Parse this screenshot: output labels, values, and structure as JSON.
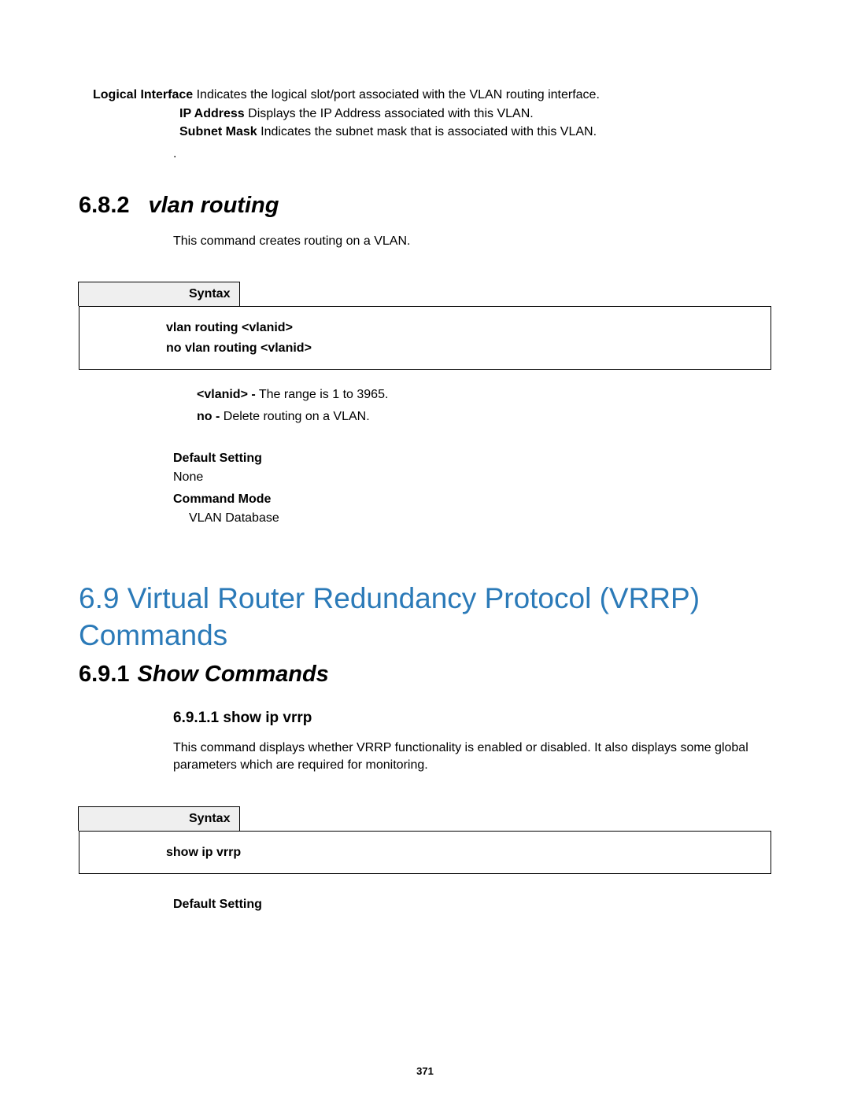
{
  "defs": {
    "logical_label": "Logical Interface",
    "logical_text": " Indicates the logical slot/port associated with the VLAN routing interface.",
    "ip_label": "IP Address",
    "ip_text": " Displays the IP Address associated with this VLAN.",
    "subnet_label": "Subnet Mask",
    "subnet_text": " Indicates the subnet mask that is associated with this VLAN.",
    "dot": "."
  },
  "s682": {
    "num": "6.8.2",
    "title": "vlan routing",
    "desc": "This command creates routing on a VLAN.",
    "syntax_label": "Syntax",
    "syntax_line1": "vlan routing <vlanid>",
    "syntax_line2": "no vlan routing <vlanid>",
    "param1_b": "<vlanid> -",
    "param1_t": " The range is 1 to 3965.",
    "param2_b": "no -",
    "param2_t": " Delete routing on a VLAN.",
    "defset_label": "Default Setting",
    "defset_value": "None",
    "cmdmode_label": "Command Mode",
    "cmdmode_value": "VLAN Database"
  },
  "s69": {
    "title": "6.9 Virtual Router Redundancy Protocol (VRRP) Commands"
  },
  "s691": {
    "num": "6.9.1",
    "title": "Show Commands"
  },
  "s6911": {
    "heading": "6.9.1.1 show ip vrrp",
    "desc": "This command displays whether VRRP functionality is enabled or disabled. It also displays some global parameters which are required for monitoring.",
    "syntax_label": "Syntax",
    "syntax_line1": "show ip vrrp",
    "defset_label": "Default Setting"
  },
  "pagenum": "371"
}
